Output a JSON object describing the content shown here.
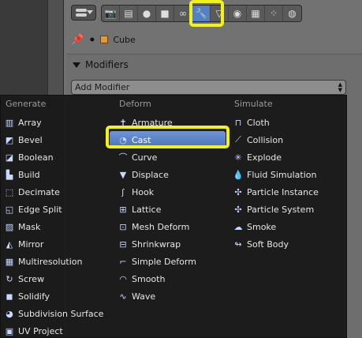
{
  "properties": {
    "tabs": [
      {
        "icon": "camera-icon",
        "glyph": "📷"
      },
      {
        "icon": "render-layers-icon",
        "glyph": "▤"
      },
      {
        "icon": "world-icon",
        "glyph": "●"
      },
      {
        "icon": "object-icon",
        "glyph": "■"
      },
      {
        "icon": "constraints-icon",
        "glyph": "∞"
      },
      {
        "icon": "wrench-icon",
        "glyph": "🔧",
        "active": true
      },
      {
        "icon": "data-icon",
        "glyph": "▽"
      },
      {
        "icon": "material-icon",
        "glyph": "◉"
      },
      {
        "icon": "texture-icon",
        "glyph": "▦"
      },
      {
        "icon": "particles-icon",
        "glyph": "⁘"
      },
      {
        "icon": "physics-icon",
        "glyph": "◍"
      }
    ],
    "context_object": "Cube"
  },
  "modifiers_panel": {
    "title": "Modifiers",
    "add_modifier_label": "Add Modifier"
  },
  "menu": {
    "columns": [
      {
        "header": "Generate",
        "items": [
          {
            "label": "Array",
            "icon": "array-icon",
            "glyph": "▥"
          },
          {
            "label": "Bevel",
            "icon": "bevel-icon",
            "glyph": "◩"
          },
          {
            "label": "Boolean",
            "icon": "boolean-icon",
            "glyph": "◪"
          },
          {
            "label": "Build",
            "icon": "build-icon",
            "glyph": "▙"
          },
          {
            "label": "Decimate",
            "icon": "decimate-icon",
            "glyph": "⬚"
          },
          {
            "label": "Edge Split",
            "icon": "edge-split-icon",
            "glyph": "◱"
          },
          {
            "label": "Mask",
            "icon": "mask-icon",
            "glyph": "▨"
          },
          {
            "label": "Mirror",
            "icon": "mirror-icon",
            "glyph": "◭"
          },
          {
            "label": "Multiresolution",
            "icon": "multiresolution-icon",
            "glyph": "▦"
          },
          {
            "label": "Screw",
            "icon": "screw-icon",
            "glyph": "↻"
          },
          {
            "label": "Solidify",
            "icon": "solidify-icon",
            "glyph": "◼"
          },
          {
            "label": "Subdivision Surface",
            "icon": "subdivision-surface-icon",
            "glyph": "◕"
          },
          {
            "label": "UV Project",
            "icon": "uv-project-icon",
            "glyph": "▣"
          }
        ]
      },
      {
        "header": "Deform",
        "items": [
          {
            "label": "Armature",
            "icon": "armature-icon",
            "glyph": "✝"
          },
          {
            "label": "Cast",
            "icon": "cast-icon",
            "glyph": "◔",
            "selected": true
          },
          {
            "label": "Curve",
            "icon": "curve-icon",
            "glyph": "⌒"
          },
          {
            "label": "Displace",
            "icon": "displace-icon",
            "glyph": "▼"
          },
          {
            "label": "Hook",
            "icon": "hook-icon",
            "glyph": "ʃ"
          },
          {
            "label": "Lattice",
            "icon": "lattice-icon",
            "glyph": "⊞"
          },
          {
            "label": "Mesh Deform",
            "icon": "mesh-deform-icon",
            "glyph": "⊡"
          },
          {
            "label": "Shrinkwrap",
            "icon": "shrinkwrap-icon",
            "glyph": "⊟"
          },
          {
            "label": "Simple Deform",
            "icon": "simple-deform-icon",
            "glyph": "⌐"
          },
          {
            "label": "Smooth",
            "icon": "smooth-icon",
            "glyph": "◠"
          },
          {
            "label": "Wave",
            "icon": "wave-icon",
            "glyph": "∿"
          }
        ]
      },
      {
        "header": "Simulate",
        "items": [
          {
            "label": "Cloth",
            "icon": "cloth-icon",
            "glyph": "⊓"
          },
          {
            "label": "Collision",
            "icon": "collision-icon",
            "glyph": "⟋"
          },
          {
            "label": "Explode",
            "icon": "explode-icon",
            "glyph": "✳"
          },
          {
            "label": "Fluid Simulation",
            "icon": "fluid-simulation-icon",
            "glyph": "💧"
          },
          {
            "label": "Particle Instance",
            "icon": "particle-instance-icon",
            "glyph": "✣"
          },
          {
            "label": "Particle System",
            "icon": "particle-system-icon",
            "glyph": "✣"
          },
          {
            "label": "Smoke",
            "icon": "smoke-icon",
            "glyph": "☁"
          },
          {
            "label": "Soft Body",
            "icon": "soft-body-icon",
            "glyph": "↬"
          }
        ]
      }
    ]
  },
  "colors": {
    "accent": "#5680c2",
    "highlight_box": "#f2f21a",
    "menu_bg": "#1a1a1a"
  }
}
